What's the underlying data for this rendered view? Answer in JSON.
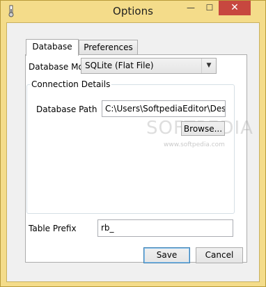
{
  "window": {
    "title": "Options",
    "minimize_glyph": "—",
    "maximize_glyph": "☐",
    "close_glyph": "✕"
  },
  "tabs": [
    {
      "label": "Database",
      "active": true
    },
    {
      "label": "Preferences",
      "active": false
    }
  ],
  "database": {
    "mode_label": "Database Mode",
    "mode_value": "SQLite (Flat File)",
    "dropdown_arrow": "▼",
    "connection_group_title": "Connection Details",
    "path_label": "Database Path",
    "path_value": "C:\\Users\\SoftpediaEditor\\Desktop",
    "browse_label": "Browse...",
    "prefix_label": "Table Prefix",
    "prefix_value": "rb_"
  },
  "footer": {
    "save_label": "Save",
    "cancel_label": "Cancel"
  },
  "watermark": {
    "text": "SOFTPEDIA",
    "url": "www.softpedia.com"
  }
}
